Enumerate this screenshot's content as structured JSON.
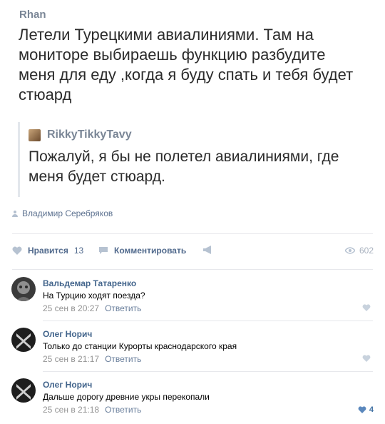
{
  "post": {
    "author": "Rhan",
    "text": "Летели Турецкими авиалиниями. Там на мониторе выбираешь функцию разбудите меня для еду ,когда я буду спать и тебя будет стюард",
    "quote": {
      "author": "RikkyTikkyTavy",
      "text": "Пожалуй, я бы не полетел авиалиниями, где меня будет стюард."
    },
    "signer": "Владимир Серебряков"
  },
  "actions": {
    "like_label": "Нравится",
    "like_count": "13",
    "comment_label": "Комментировать",
    "views": "602"
  },
  "comments": [
    {
      "author": "Вальдемар Татаренко",
      "text": "На Турцию ходят поезда?",
      "date": "25 сен в 20:27",
      "reply": "Ответить",
      "likes": ""
    },
    {
      "author": "Олег Норич",
      "text": "Только до станции Курорты краснодарского края",
      "date": "25 сен в 21:17",
      "reply": "Ответить",
      "likes": ""
    },
    {
      "author": "Олег Норич",
      "text": "Дальше дорогу древние укры перекопали",
      "date": "25 сен в 21:18",
      "reply": "Ответить",
      "likes": "4"
    }
  ],
  "colors": {
    "link": "#42648b",
    "muted": "#939393",
    "like_active": "#3c6ea1"
  }
}
